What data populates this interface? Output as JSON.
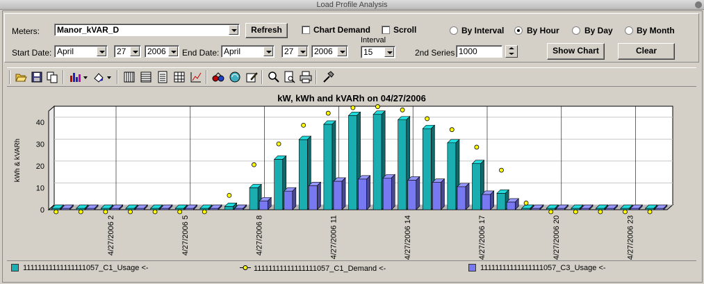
{
  "window": {
    "title": "Load Profile Analysis"
  },
  "controls": {
    "meters_label": "Meters:",
    "meter_value": "Manor_kVAR_D",
    "refresh_label": "Refresh",
    "chart_demand_label": "Chart Demand",
    "scroll_label": "Scroll",
    "by_interval_label": "By Interval",
    "by_hour_label": "By Hour",
    "by_day_label": "By Day",
    "by_month_label": "By Month",
    "start_date_label": "Start Date:",
    "start_month": "April",
    "start_day": "27",
    "start_year": "2006",
    "end_date_label": "End Date:",
    "end_month": "April",
    "end_day": "27",
    "end_year": "2006",
    "interval_label": "Interval",
    "interval_value": "15",
    "second_series_label": "2nd Series",
    "second_series_value": "1000",
    "show_chart_label": "Show Chart",
    "clear_label": "Clear",
    "chart_demand_checked": false,
    "scroll_checked": false,
    "selected_mode": "By Hour"
  },
  "toolbar": {
    "icons": [
      "open-icon",
      "save-icon",
      "copy-icon",
      "bar-chart-type-icon",
      "palette-icon",
      "vertical-grid-icon",
      "horizontal-grid-icon",
      "legend-icon",
      "data-grid-icon",
      "axis-icon",
      "3d-view-icon",
      "rotate-icon",
      "edit-series-icon",
      "zoom-icon",
      "print-preview-icon",
      "print-icon",
      "tools-icon"
    ]
  },
  "chart_data": {
    "type": "bar",
    "title": "kW, kWh and kVARh on 04/27/2006",
    "ylabel": "kWh & kVARh",
    "xlabel": "",
    "ylim": [
      0,
      45
    ],
    "yticks": [
      0,
      10,
      20,
      30,
      40
    ],
    "categories": [
      "4/27/2006 0",
      "4/27/2006 1",
      "4/27/2006 2",
      "4/27/2006 3",
      "4/27/2006 4",
      "4/27/2006 5",
      "4/27/2006 6",
      "4/27/2006 7",
      "4/27/2006 8",
      "4/27/2006 9",
      "4/27/2006 10",
      "4/27/2006 11",
      "4/27/2006 12",
      "4/27/2006 13",
      "4/27/2006 14",
      "4/27/2006 15",
      "4/27/2006 16",
      "4/27/2006 17",
      "4/27/2006 18",
      "4/27/2006 19",
      "4/27/2006 20",
      "4/27/2006 21",
      "4/27/2006 22",
      "4/27/2006 23",
      "4/27/2006 24"
    ],
    "shown_xlabels": [
      "4/27/2006 2",
      "4/27/2006 5",
      "4/27/2006 8",
      "4/27/2006 11",
      "4/27/2006 14",
      "4/27/2006 17",
      "4/27/2006 20",
      "4/27/2006 23"
    ],
    "shown_xlabel_indices": [
      2,
      5,
      8,
      11,
      14,
      17,
      20,
      23
    ],
    "grid": true,
    "legend_placement": "bottom",
    "series": [
      {
        "name": "11111111111111111057_C1_Usage <-",
        "type": "bar",
        "color": "#1aaeb0",
        "values": [
          0,
          0,
          0,
          0,
          0,
          0,
          0,
          1.5,
          10,
          23,
          32,
          39,
          43,
          43.5,
          41,
          37,
          30.5,
          21,
          7.5,
          0,
          0,
          0,
          0,
          0,
          0
        ]
      },
      {
        "name": "11111111111111111057_C1_Demand <-",
        "type": "point",
        "color": "#ffff00",
        "values": [
          0,
          0,
          0,
          0,
          0,
          0,
          0,
          4,
          18,
          27.5,
          36,
          41.5,
          44,
          44.5,
          43,
          39,
          34,
          26,
          15.5,
          0.5,
          0,
          0,
          0,
          0,
          0
        ]
      },
      {
        "name": "11111111111111111057_C3_Usage <-",
        "type": "bar",
        "color": "#7878f0",
        "values": [
          0,
          0,
          0,
          0,
          0,
          0,
          0,
          0.5,
          4,
          8.5,
          11,
          13,
          14,
          14.5,
          13.5,
          12.5,
          10.5,
          7,
          3.5,
          0.5,
          0,
          0,
          0,
          0,
          0
        ]
      }
    ]
  }
}
